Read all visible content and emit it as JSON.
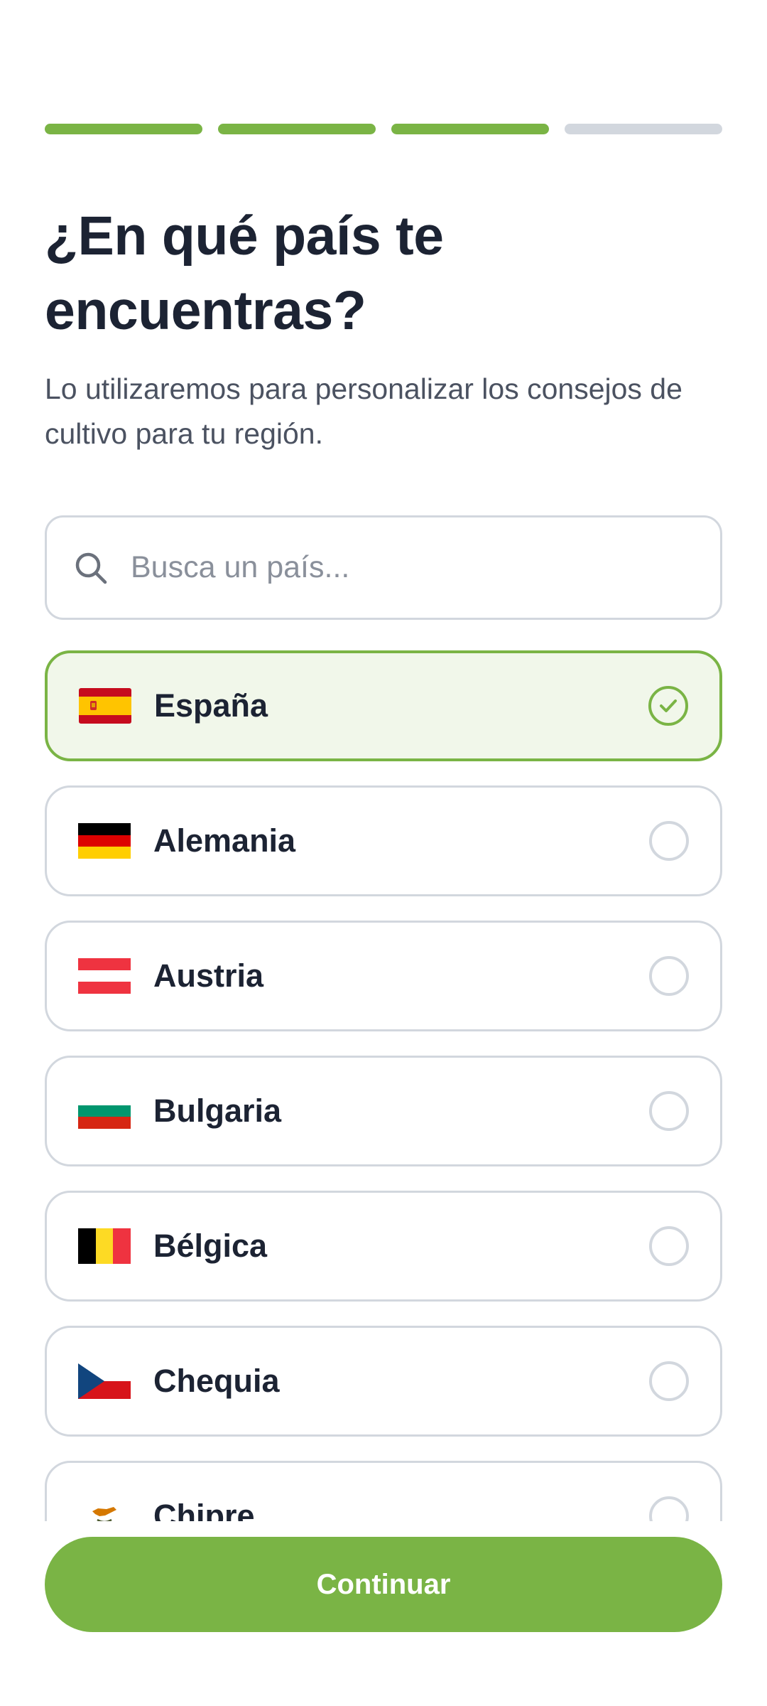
{
  "progress": {
    "total_steps": 4,
    "completed_steps": 3
  },
  "header": {
    "title": "¿En qué país te encuentras?",
    "subtitle": "Lo utilizaremos para personalizar los consejos de cultivo para tu región."
  },
  "search": {
    "placeholder": "Busca un país...",
    "value": "",
    "icon": "search-icon"
  },
  "countries": [
    {
      "name": "España",
      "flag": "spain-flag-icon",
      "selected": true
    },
    {
      "name": "Alemania",
      "flag": "germany-flag-icon",
      "selected": false
    },
    {
      "name": "Austria",
      "flag": "austria-flag-icon",
      "selected": false
    },
    {
      "name": "Bulgaria",
      "flag": "bulgaria-flag-icon",
      "selected": false
    },
    {
      "name": "Bélgica",
      "flag": "belgium-flag-icon",
      "selected": false
    },
    {
      "name": "Chequia",
      "flag": "czechia-flag-icon",
      "selected": false
    },
    {
      "name": "Chipre",
      "flag": "cyprus-flag-icon",
      "selected": false
    }
  ],
  "footer": {
    "continue_label": "Continuar"
  },
  "colors": {
    "accent": "#7ab445",
    "selected_background": "#f1f7ea",
    "border": "#d2d7de",
    "text": "#1c2333",
    "subtext": "#4b5261"
  }
}
